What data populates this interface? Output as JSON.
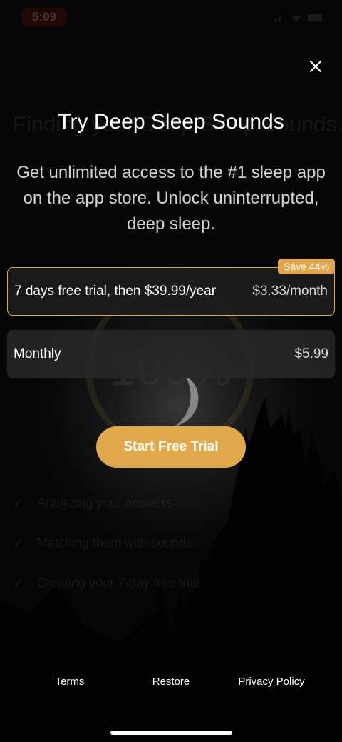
{
  "status_bar": {
    "time": "5:09"
  },
  "background": {
    "heading": "Finding your Deep Sleep Sounds...",
    "progress_text": "100%",
    "steps": [
      {
        "label": "Analyzing your answers"
      },
      {
        "label": "Matching them with sounds"
      },
      {
        "label": "Creating your 7-day free trial"
      }
    ]
  },
  "paywall": {
    "title": "Try Deep Sleep Sounds",
    "subtitle": "Get unlimited access to the #1 sleep app on the app store. Unlock uninterrupted, deep sleep.",
    "plans": [
      {
        "label": "7 days free trial, then $39.99/year",
        "price": "$3.33/month",
        "badge": "Save 44%",
        "selected": true
      },
      {
        "label": "Monthly",
        "price": "$5.99",
        "selected": false
      }
    ],
    "cta": "Start Free Trial",
    "accent_color": "#e0a84a",
    "footer": {
      "terms": "Terms",
      "restore": "Restore",
      "privacy": "Privacy Policy"
    }
  }
}
